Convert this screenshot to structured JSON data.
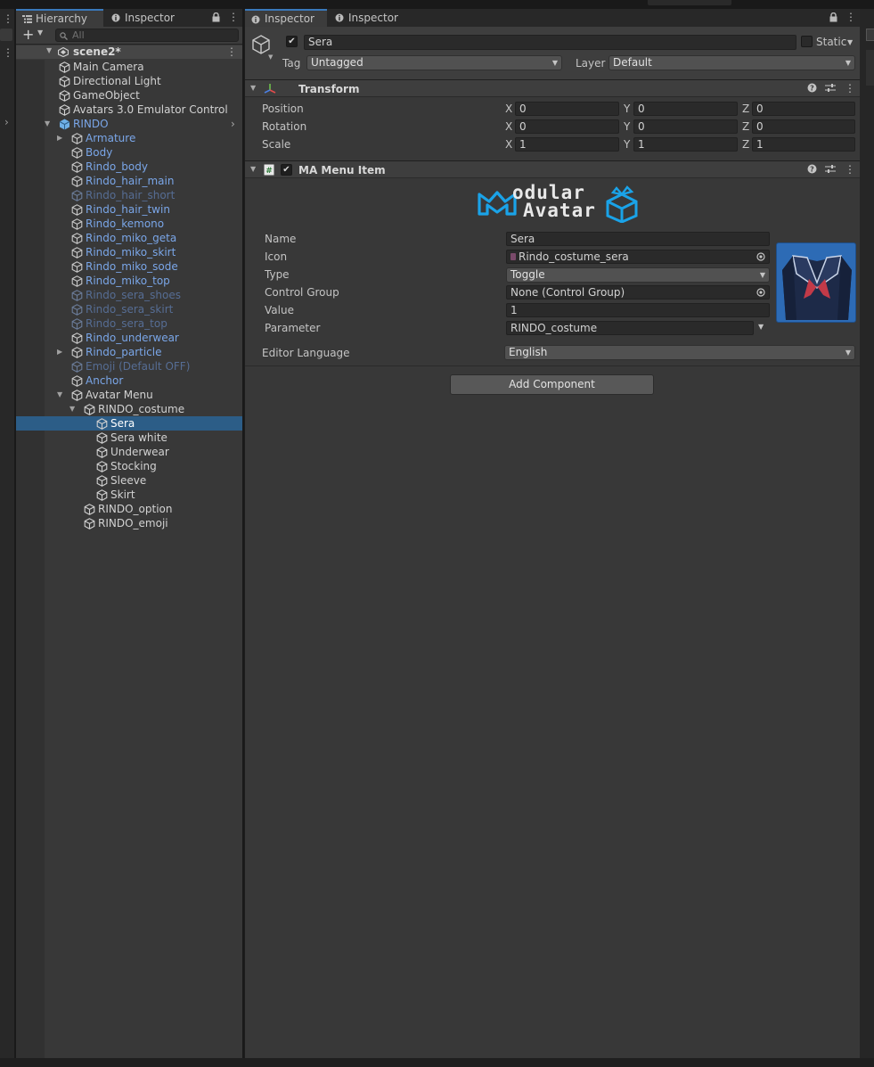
{
  "hierarchy": {
    "tab_label": "Hierarchy",
    "inspector_tab_label": "Inspector",
    "search_placeholder": "All",
    "scene_name": "scene2*",
    "items": [
      {
        "label": "Main Camera",
        "color": "white",
        "depth": 0,
        "arrow": "",
        "selected": false
      },
      {
        "label": "Directional Light",
        "color": "white",
        "depth": 0,
        "arrow": "",
        "selected": false
      },
      {
        "label": "GameObject",
        "color": "white",
        "depth": 0,
        "arrow": "",
        "selected": false
      },
      {
        "label": "Avatars 3.0 Emulator Control",
        "color": "white",
        "depth": 0,
        "arrow": "",
        "selected": false
      },
      {
        "label": "RINDO",
        "color": "blue",
        "depth": 0,
        "arrow": "down",
        "selected": false,
        "icon": "prefab-root-icon"
      },
      {
        "label": "Armature",
        "color": "blue",
        "depth": 1,
        "arrow": "right",
        "selected": false
      },
      {
        "label": "Body",
        "color": "blue",
        "depth": 1,
        "arrow": "",
        "selected": false
      },
      {
        "label": "Rindo_body",
        "color": "blue",
        "depth": 1,
        "arrow": "",
        "selected": false
      },
      {
        "label": "Rindo_hair_main",
        "color": "blue",
        "depth": 1,
        "arrow": "",
        "selected": false
      },
      {
        "label": "Rindo_hair_short",
        "color": "dim",
        "depth": 1,
        "arrow": "",
        "selected": false
      },
      {
        "label": "Rindo_hair_twin",
        "color": "blue",
        "depth": 1,
        "arrow": "",
        "selected": false
      },
      {
        "label": "Rindo_kemono",
        "color": "blue",
        "depth": 1,
        "arrow": "",
        "selected": false
      },
      {
        "label": "Rindo_miko_geta",
        "color": "blue",
        "depth": 1,
        "arrow": "",
        "selected": false
      },
      {
        "label": "Rindo_miko_skirt",
        "color": "blue",
        "depth": 1,
        "arrow": "",
        "selected": false
      },
      {
        "label": "Rindo_miko_sode",
        "color": "blue",
        "depth": 1,
        "arrow": "",
        "selected": false
      },
      {
        "label": "Rindo_miko_top",
        "color": "blue",
        "depth": 1,
        "arrow": "",
        "selected": false
      },
      {
        "label": "Rindo_sera_shoes",
        "color": "dim",
        "depth": 1,
        "arrow": "",
        "selected": false
      },
      {
        "label": "Rindo_sera_skirt",
        "color": "dim",
        "depth": 1,
        "arrow": "",
        "selected": false
      },
      {
        "label": "Rindo_sera_top",
        "color": "dim",
        "depth": 1,
        "arrow": "",
        "selected": false
      },
      {
        "label": "Rindo_underwear",
        "color": "blue",
        "depth": 1,
        "arrow": "",
        "selected": false
      },
      {
        "label": "Rindo_particle",
        "color": "blue",
        "depth": 1,
        "arrow": "right",
        "selected": false
      },
      {
        "label": "Emoji (Default OFF)",
        "color": "dim",
        "depth": 1,
        "arrow": "",
        "selected": false
      },
      {
        "label": "Anchor",
        "color": "blue",
        "depth": 1,
        "arrow": "",
        "selected": false
      },
      {
        "label": "Avatar Menu",
        "color": "white",
        "depth": 1,
        "arrow": "down",
        "selected": false
      },
      {
        "label": "RINDO_costume",
        "color": "white",
        "depth": 2,
        "arrow": "down",
        "selected": false
      },
      {
        "label": "Sera",
        "color": "white",
        "depth": 3,
        "arrow": "",
        "selected": true
      },
      {
        "label": "Sera white",
        "color": "white",
        "depth": 3,
        "arrow": "",
        "selected": false
      },
      {
        "label": "Underwear",
        "color": "white",
        "depth": 3,
        "arrow": "",
        "selected": false
      },
      {
        "label": "Stocking",
        "color": "white",
        "depth": 3,
        "arrow": "",
        "selected": false
      },
      {
        "label": "Sleeve",
        "color": "white",
        "depth": 3,
        "arrow": "",
        "selected": false
      },
      {
        "label": "Skirt",
        "color": "white",
        "depth": 3,
        "arrow": "",
        "selected": false
      },
      {
        "label": "RINDO_option",
        "color": "white",
        "depth": 2,
        "arrow": "",
        "selected": false
      },
      {
        "label": "RINDO_emoji",
        "color": "white",
        "depth": 2,
        "arrow": "",
        "selected": false
      }
    ]
  },
  "inspector": {
    "tabs": [
      "Inspector",
      "Inspector"
    ],
    "object_name": "Sera",
    "static_label": "Static",
    "tag_label": "Tag",
    "tag_value": "Untagged",
    "layer_label": "Layer",
    "layer_value": "Default",
    "transform": {
      "title": "Transform",
      "rows": [
        {
          "label": "Position",
          "x": "0",
          "y": "0",
          "z": "0"
        },
        {
          "label": "Rotation",
          "x": "0",
          "y": "0",
          "z": "0"
        },
        {
          "label": "Scale",
          "x": "1",
          "y": "1",
          "z": "1"
        }
      ]
    },
    "ma_menu_item": {
      "title": "MA Menu Item",
      "logo_line1": "odular",
      "logo_line2": "Avatar",
      "fields": {
        "name_label": "Name",
        "name_value": "Sera",
        "icon_label": "Icon",
        "icon_value": "Rindo_costume_sera",
        "type_label": "Type",
        "type_value": "Toggle",
        "control_group_label": "Control Group",
        "control_group_value": "None (Control Group)",
        "value_label": "Value",
        "value_value": "1",
        "parameter_label": "Parameter",
        "parameter_value": "RINDO_costume"
      },
      "editor_language_label": "Editor Language",
      "editor_language_value": "English"
    },
    "add_component_label": "Add Component"
  },
  "colors": {
    "selection": "#2c5d87",
    "prefab_blue": "#7aa6e8",
    "accent": "#3a79bb"
  }
}
